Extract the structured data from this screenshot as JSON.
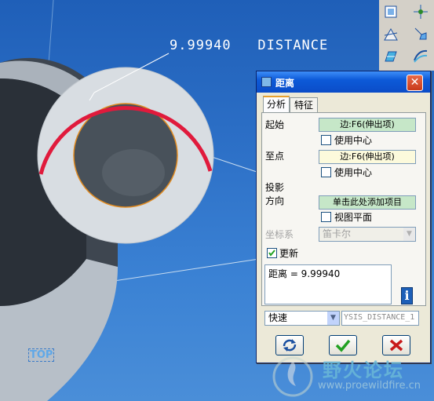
{
  "viewport": {
    "dimension_value": "9.99940",
    "dimension_label": "DISTANCE",
    "view_label": "TOP"
  },
  "toolbar": {
    "icons": [
      "datum-plane-icon",
      "datum-point-icon",
      "datum-axis-icon",
      "datum-csys-icon",
      "sketch-icon",
      "analysis-curve-icon"
    ]
  },
  "dialog": {
    "title": "距离",
    "close_label": "✕",
    "tabs": [
      {
        "label": "分析"
      },
      {
        "label": "特征"
      }
    ],
    "from_label": "起始",
    "from_value": "边:F6(伸出项)",
    "from_use_center": "使用中心",
    "to_label": "至点",
    "to_value": "边:F6(伸出项)",
    "to_use_center": "使用中心",
    "projection_label": "投影",
    "direction_label": "方向",
    "direction_value": "单击此处添加项目",
    "view_plane_label": "视图平面",
    "csys_label": "坐标系",
    "csys_value": "笛卡尔",
    "update_label": "更新",
    "update_checked": true,
    "result_text": "距离 = 9.99940",
    "mode_value": "快速",
    "name_value": "YSIS_DISTANCE_1",
    "info_label": "i"
  },
  "watermark": {
    "title": "野火论坛",
    "url": "www.proewildfire.cn"
  },
  "colors": {
    "viewport_blue": "#2c6fc6",
    "measure_red": "#e01a3c",
    "part_gray": "#d8dde2",
    "dialog_bg": "#ece9d8",
    "titlebar_blue": "#0d5ad8"
  }
}
